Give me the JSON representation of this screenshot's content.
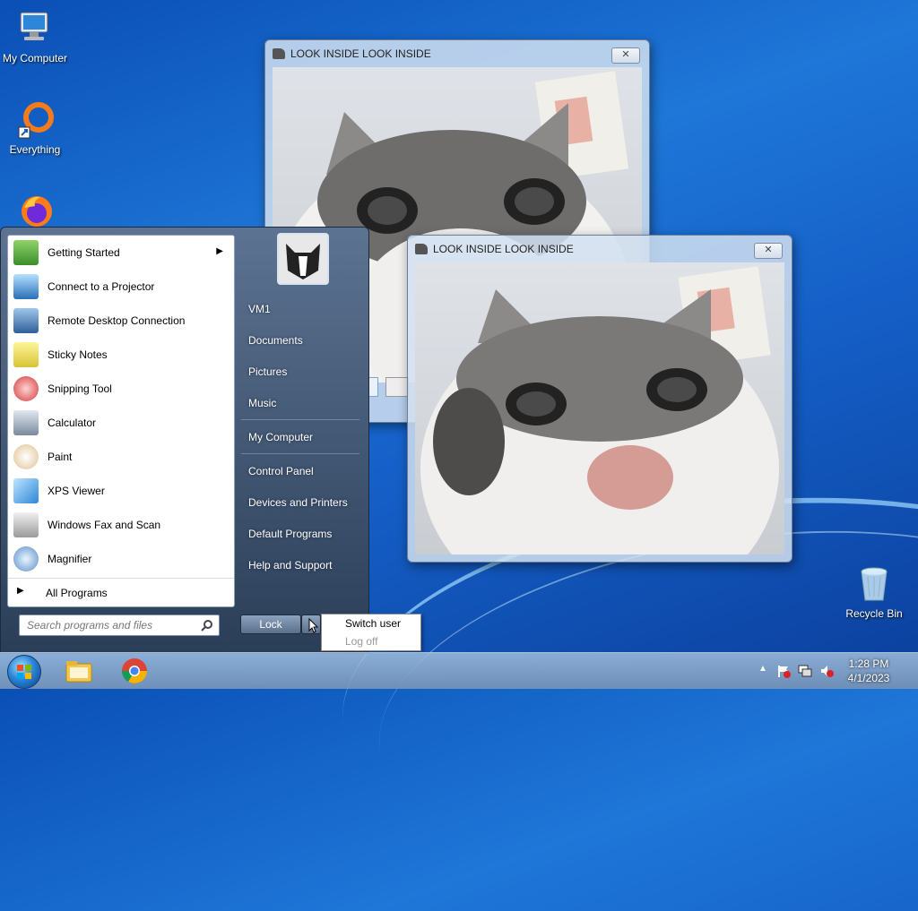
{
  "desktop": {
    "icons": [
      {
        "label": "My Computer",
        "icon": "computer-icon"
      },
      {
        "label": "Everything",
        "icon": "everything-icon"
      },
      {
        "label": "",
        "icon": "firefox-icon"
      },
      {
        "label": "Recycle Bin",
        "icon": "recycle-bin-icon"
      }
    ]
  },
  "windows": [
    {
      "title": "LOOK INSIDE LOOK INSIDE",
      "close": "✕"
    },
    {
      "title": "LOOK INSIDE LOOK INSIDE",
      "close": "✕"
    }
  ],
  "start_menu": {
    "programs": [
      {
        "label": "Getting Started",
        "icon": "getting-started-icon",
        "has_submenu": true
      },
      {
        "label": "Connect to a Projector",
        "icon": "projector-icon"
      },
      {
        "label": "Remote Desktop Connection",
        "icon": "remote-desktop-icon"
      },
      {
        "label": "Sticky Notes",
        "icon": "sticky-notes-icon"
      },
      {
        "label": "Snipping Tool",
        "icon": "snipping-tool-icon"
      },
      {
        "label": "Calculator",
        "icon": "calculator-icon"
      },
      {
        "label": "Paint",
        "icon": "paint-icon"
      },
      {
        "label": "XPS Viewer",
        "icon": "xps-viewer-icon"
      },
      {
        "label": "Windows Fax and Scan",
        "icon": "fax-scan-icon"
      },
      {
        "label": "Magnifier",
        "icon": "magnifier-icon"
      }
    ],
    "all_programs": "All Programs",
    "search_placeholder": "Search programs and files",
    "right_items": [
      "VM1",
      "Documents",
      "Pictures",
      "Music",
      "My Computer",
      "Control Panel",
      "Devices and Printers",
      "Default Programs",
      "Help and Support"
    ],
    "lock_label": "Lock",
    "power_popup": {
      "switch_user": "Switch user",
      "log_off": "Log off"
    }
  },
  "taskbar": {
    "pinned": [
      "explorer-icon",
      "chrome-icon"
    ],
    "clock_time": "1:28 PM",
    "clock_date": "4/1/2023"
  },
  "colors": {
    "accent": "#1f77d8",
    "taskbar": "#8fb0d2"
  }
}
